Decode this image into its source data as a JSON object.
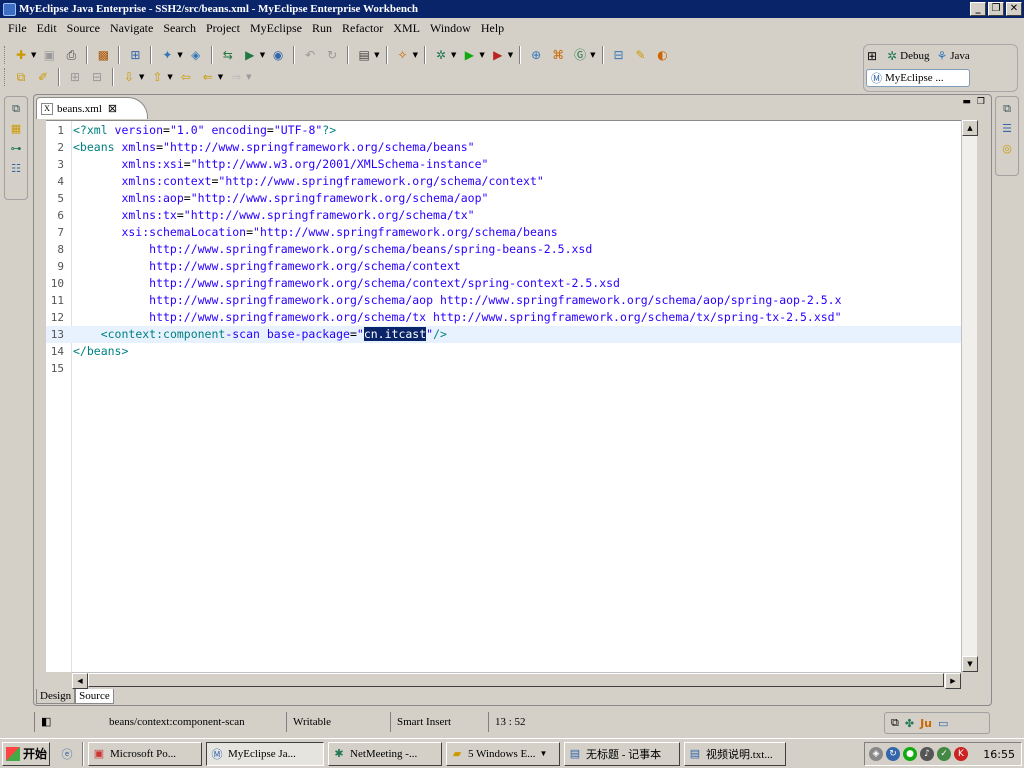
{
  "window": {
    "title": "MyEclipse Java Enterprise - SSH2/src/beans.xml - MyEclipse Enterprise Workbench"
  },
  "menu": [
    "File",
    "Edit",
    "Source",
    "Navigate",
    "Search",
    "Project",
    "MyEclipse",
    "Run",
    "Refactor",
    "XML",
    "Window",
    "Help"
  ],
  "perspectives": {
    "debug": "Debug",
    "java": "Java",
    "myeclipse": "MyEclipse ..."
  },
  "editor": {
    "tab_label": "beans.xml",
    "bottom_tabs": [
      "Design",
      "Source"
    ],
    "active_bottom_tab": "Source",
    "lines": [
      {
        "n": "1",
        "text": "<?xml version=\"1.0\" encoding=\"UTF-8\"?>"
      },
      {
        "n": "2",
        "text": "<beans xmlns=\"http://www.springframework.org/schema/beans\""
      },
      {
        "n": "3",
        "text": "       xmlns:xsi=\"http://www.w3.org/2001/XMLSchema-instance\""
      },
      {
        "n": "4",
        "text": "       xmlns:context=\"http://www.springframework.org/schema/context\""
      },
      {
        "n": "5",
        "text": "       xmlns:aop=\"http://www.springframework.org/schema/aop\""
      },
      {
        "n": "6",
        "text": "       xmlns:tx=\"http://www.springframework.org/schema/tx\""
      },
      {
        "n": "7",
        "text": "       xsi:schemaLocation=\"http://www.springframework.org/schema/beans"
      },
      {
        "n": "8",
        "text": "           http://www.springframework.org/schema/beans/spring-beans-2.5.xsd"
      },
      {
        "n": "9",
        "text": "           http://www.springframework.org/schema/context"
      },
      {
        "n": "10",
        "text": "           http://www.springframework.org/schema/context/spring-context-2.5.xsd"
      },
      {
        "n": "11",
        "text": "           http://www.springframework.org/schema/aop http://www.springframework.org/schema/aop/spring-aop-2.5.x"
      },
      {
        "n": "12",
        "text": "           http://www.springframework.org/schema/tx http://www.springframework.org/schema/tx/spring-tx-2.5.xsd\""
      },
      {
        "n": "13",
        "text": "    <context:component-scan base-package=\"cn.itcast\"/>"
      },
      {
        "n": "14",
        "text": "</beans>"
      },
      {
        "n": "15",
        "text": ""
      }
    ],
    "selected_text": "cn.itcast"
  },
  "status": {
    "path": "beans/context:component-scan",
    "writable": "Writable",
    "insert_mode": "Smart Insert",
    "position": "13 : 52"
  },
  "taskbar": {
    "start": "开始",
    "tasks": [
      "Microsoft Po...",
      "MyEclipse Ja...",
      "NetMeeting -...",
      "5 Windows E...",
      "无标题 - 记事本",
      "视频说明.txt..."
    ],
    "active_task": "MyEclipse Ja...",
    "clock": "16:55"
  },
  "colors": {
    "titlebar": "#0a246a",
    "tag": "#008080",
    "attr": "#7f007f",
    "value": "#2a00ff",
    "selection": "#0a246a"
  }
}
